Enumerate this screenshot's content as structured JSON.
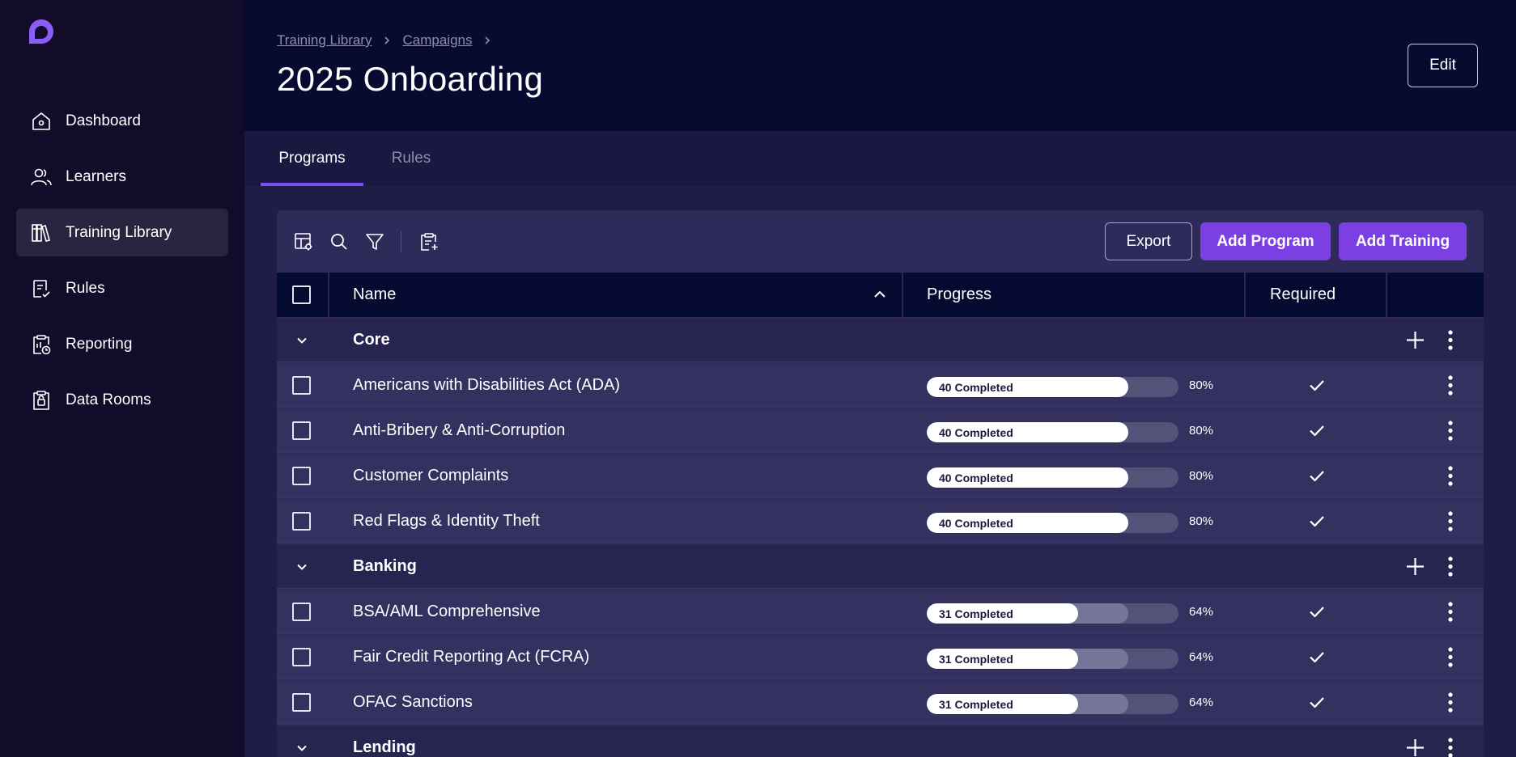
{
  "sidebar": {
    "items": [
      {
        "label": "Dashboard",
        "icon": "home-icon"
      },
      {
        "label": "Learners",
        "icon": "users-icon"
      },
      {
        "label": "Training Library",
        "icon": "library-icon",
        "active": true
      },
      {
        "label": "Rules",
        "icon": "rules-icon"
      },
      {
        "label": "Reporting",
        "icon": "reporting-icon"
      },
      {
        "label": "Data Rooms",
        "icon": "data-rooms-icon"
      }
    ]
  },
  "header": {
    "breadcrumb": [
      "Training Library",
      "Campaigns"
    ],
    "title": "2025 Onboarding",
    "edit_label": "Edit"
  },
  "tabs": [
    {
      "label": "Programs",
      "active": true
    },
    {
      "label": "Rules",
      "active": false
    }
  ],
  "toolbar": {
    "icons": [
      "table-settings-icon",
      "search-icon",
      "filter-icon",
      "clipboard-add-icon"
    ],
    "export_label": "Export",
    "add_program_label": "Add Program",
    "add_training_label": "Add Training"
  },
  "table": {
    "columns": {
      "name": "Name",
      "progress": "Progress",
      "required": "Required"
    },
    "groups": [
      {
        "name": "Core",
        "rows": [
          {
            "name": "Americans with Disabilities Act (ADA)",
            "completed": "40 Completed",
            "fill": 0.8,
            "pct": "80%",
            "required": true
          },
          {
            "name": "Anti-Bribery & Anti-Corruption",
            "completed": "40 Completed",
            "fill": 0.8,
            "pct": "80%",
            "required": true
          },
          {
            "name": "Customer Complaints",
            "completed": "40 Completed",
            "fill": 0.8,
            "pct": "80%",
            "required": true
          },
          {
            "name": "Red Flags & Identity Theft",
            "completed": "40 Completed",
            "fill": 0.8,
            "pct": "80%",
            "required": true
          }
        ]
      },
      {
        "name": "Banking",
        "rows": [
          {
            "name": "BSA/AML Comprehensive",
            "completed": "31 Completed",
            "fill": 0.6,
            "mid": 0.8,
            "pct": "64%",
            "required": true
          },
          {
            "name": "Fair Credit Reporting Act (FCRA)",
            "completed": "31 Completed",
            "fill": 0.6,
            "mid": 0.8,
            "pct": "64%",
            "required": true
          },
          {
            "name": "OFAC Sanctions",
            "completed": "31 Completed",
            "fill": 0.6,
            "mid": 0.8,
            "pct": "64%",
            "required": true
          }
        ]
      },
      {
        "name": "Lending",
        "rows": []
      }
    ]
  },
  "colors": {
    "accent": "#7b3fe4",
    "sidebar_bg": "#130b2a",
    "header_bg": "#070b30",
    "card_bg": "#2e2a5a"
  }
}
